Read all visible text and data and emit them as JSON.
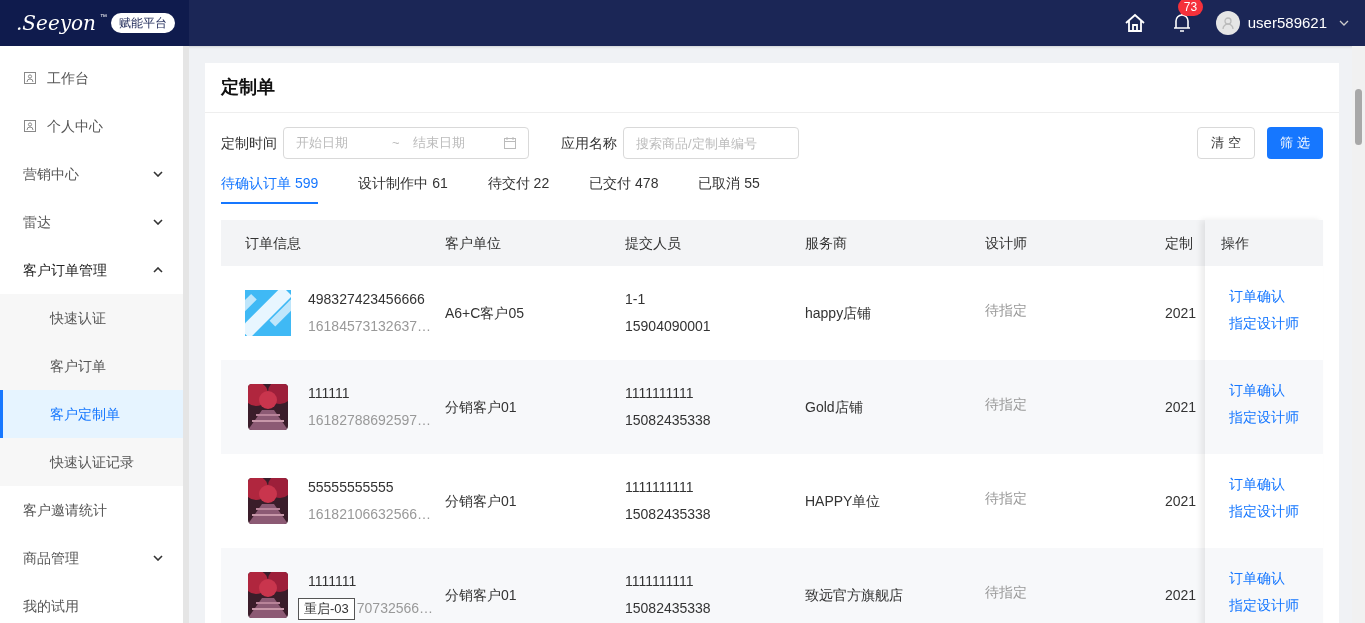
{
  "header": {
    "logo": ".Seeyon",
    "logo_tm": "™",
    "platform_badge": "赋能平台",
    "notifications": "73",
    "username": "user589621"
  },
  "sidebar": {
    "items": [
      {
        "label": "工作台",
        "kind": "page",
        "expanded": false
      },
      {
        "label": "个人中心",
        "kind": "page",
        "expanded": false
      },
      {
        "label": "营销中心",
        "kind": "group",
        "expanded": false
      },
      {
        "label": "雷达",
        "kind": "group",
        "expanded": false
      },
      {
        "label": "客户订单管理",
        "kind": "group",
        "expanded": true,
        "children": [
          {
            "label": "快速认证",
            "selected": false
          },
          {
            "label": "客户订单",
            "selected": false
          },
          {
            "label": "客户定制单",
            "selected": true
          },
          {
            "label": "快速认证记录",
            "selected": false
          }
        ]
      },
      {
        "label": "客户邀请统计",
        "kind": "plain",
        "expanded": false
      },
      {
        "label": "商品管理",
        "kind": "group",
        "expanded": false
      },
      {
        "label": "我的试用",
        "kind": "plain",
        "expanded": false
      }
    ]
  },
  "page": {
    "title": "定制单",
    "filters": {
      "date_label": "定制时间",
      "start_placeholder": "开始日期",
      "separator": "~",
      "end_placeholder": "结束日期",
      "app_label": "应用名称",
      "app_placeholder": "搜索商品/定制单编号",
      "clear_button": "清 空",
      "filter_button": "筛 选"
    },
    "tabs": [
      {
        "label": "待确认订单 599",
        "selected": true
      },
      {
        "label": "设计制作中 61",
        "selected": false
      },
      {
        "label": "待交付 22",
        "selected": false
      },
      {
        "label": "已交付 478",
        "selected": false
      },
      {
        "label": "已取消 55",
        "selected": false
      }
    ],
    "table": {
      "columns": [
        "订单信息",
        "客户单位",
        "提交人员",
        "服务商",
        "设计师",
        "定制",
        "操作"
      ],
      "rows": [
        {
          "order_no": "498327423456666",
          "order_sub": "16184573132637…",
          "customer": "A6+C客户05",
          "submitter": "1-1",
          "phone": "15904090001",
          "provider": "happy店铺",
          "designer": "待指定",
          "date": "2021",
          "actions": [
            "订单确认",
            "指定设计师"
          ]
        },
        {
          "order_no": "111111",
          "order_sub": "16182788692597…",
          "customer": "分销客户01",
          "submitter": "1111111111",
          "phone": "15082435338",
          "provider": "Gold店铺",
          "designer": "待指定",
          "date": "2021",
          "actions": [
            "订单确认",
            "指定设计师"
          ]
        },
        {
          "order_no": "55555555555",
          "order_sub": "16182106632566…",
          "customer": "分销客户01",
          "submitter": "1111111111",
          "phone": "15082435338",
          "provider": "HAPPY单位",
          "designer": "待指定",
          "date": "2021",
          "actions": [
            "订单确认",
            "指定设计师"
          ]
        },
        {
          "order_no": "1111111",
          "order_sub": "70732566…",
          "tooltip": "重启-03",
          "customer": "分销客户01",
          "submitter": "1111111111",
          "phone": "15082435338",
          "provider": "致远官方旗舰店",
          "designer": "待指定",
          "date": "2021",
          "actions": [
            "订单确认",
            "指定设计师"
          ]
        }
      ]
    }
  }
}
